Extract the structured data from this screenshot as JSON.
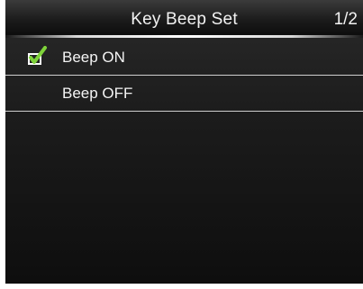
{
  "header": {
    "title": "Key Beep Set",
    "page_indicator": "1/2"
  },
  "menu": {
    "items": [
      {
        "label": "Beep ON",
        "selected": true,
        "icon": "checkmark-icon"
      },
      {
        "label": "Beep OFF",
        "selected": false
      }
    ]
  },
  "colors": {
    "background": "#141414",
    "text": "#f4f4f4",
    "checkmark": "#7fd33a",
    "divider": "#cfcfcf"
  }
}
